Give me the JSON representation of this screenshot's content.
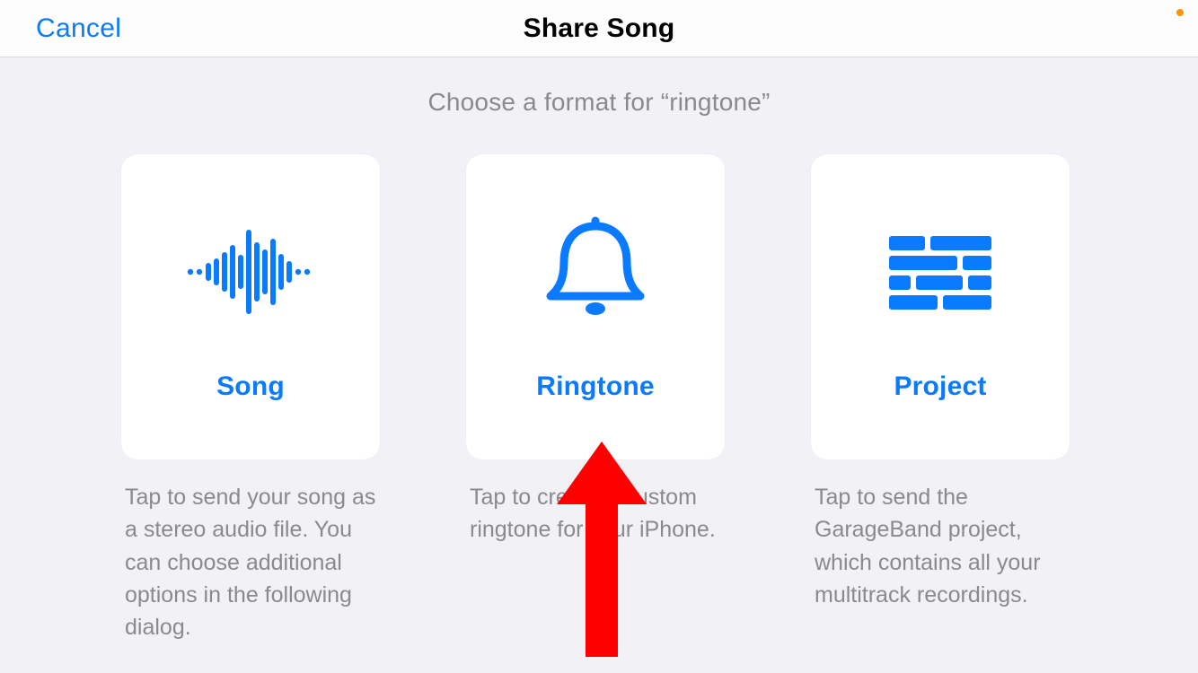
{
  "navbar": {
    "cancel_label": "Cancel",
    "title": "Share Song"
  },
  "subtitle": "Choose a format for “ringtone”",
  "options": [
    {
      "icon": "waveform-icon",
      "title": "Song",
      "description": "Tap to send your song as a stereo audio file. You can choose additional options in the following dialog."
    },
    {
      "icon": "bell-icon",
      "title": "Ringtone",
      "description": "Tap to create a custom ringtone for your iPhone."
    },
    {
      "icon": "bricks-icon",
      "title": "Project",
      "description": "Tap to send the GarageBand project, which contains all your multitrack recordings."
    }
  ],
  "annotation": {
    "arrow_color": "#ff0000"
  },
  "colors": {
    "accent": "#0a7aff",
    "muted": "#8a8a8e",
    "status_dot": "#ff9400"
  }
}
